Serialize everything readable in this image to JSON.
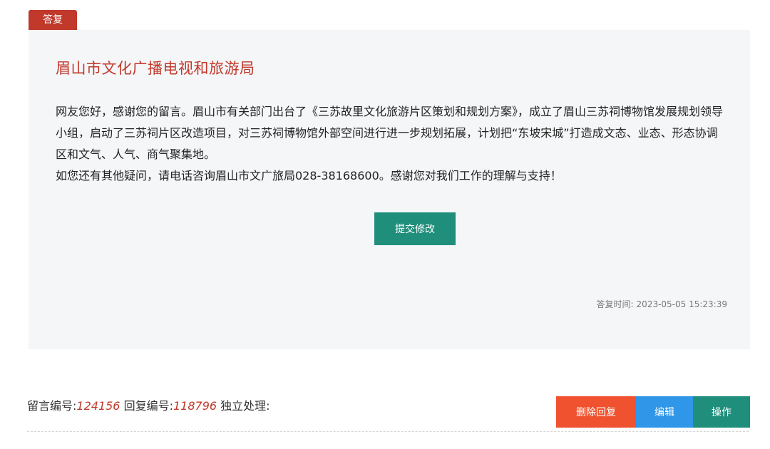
{
  "reply_tag": "答复",
  "reply": {
    "org_name": "眉山市文化广播电视和旅游局",
    "paragraph1": "网友您好，感谢您的留言。眉山市有关部门出台了《三苏故里文化旅游片区策划和规划方案》，成立了眉山三苏祠博物馆发展规划领导小组，启动了三苏祠片区改造项目，对三苏祠博物馆外部空间进行进一步规划拓展，计划把“东坡宋城”打造成文态、业态、形态协调区和文气、人气、商气聚集地。",
    "paragraph2": "如您还有其他疑问，请电话咨询眉山市文广旅局028-38168600。感谢您对我们工作的理解与支持！",
    "submit_edit_label": "提交修改",
    "time_label": "答复时间:",
    "time_value": "2023-05-05 15:23:39"
  },
  "footer": {
    "message_no_label": "留言编号:",
    "message_no": "124156",
    "reply_no_label": "回复编号:",
    "reply_no": "118796",
    "handling_label": "独立处理:",
    "buttons": {
      "delete_label": "删除回复",
      "edit_label": "编辑",
      "operate_label": "操作"
    }
  },
  "colors": {
    "accent_red": "#c0392b",
    "teal": "#1f8f7c",
    "orange_red": "#f0522f",
    "blue": "#2f96e8"
  }
}
